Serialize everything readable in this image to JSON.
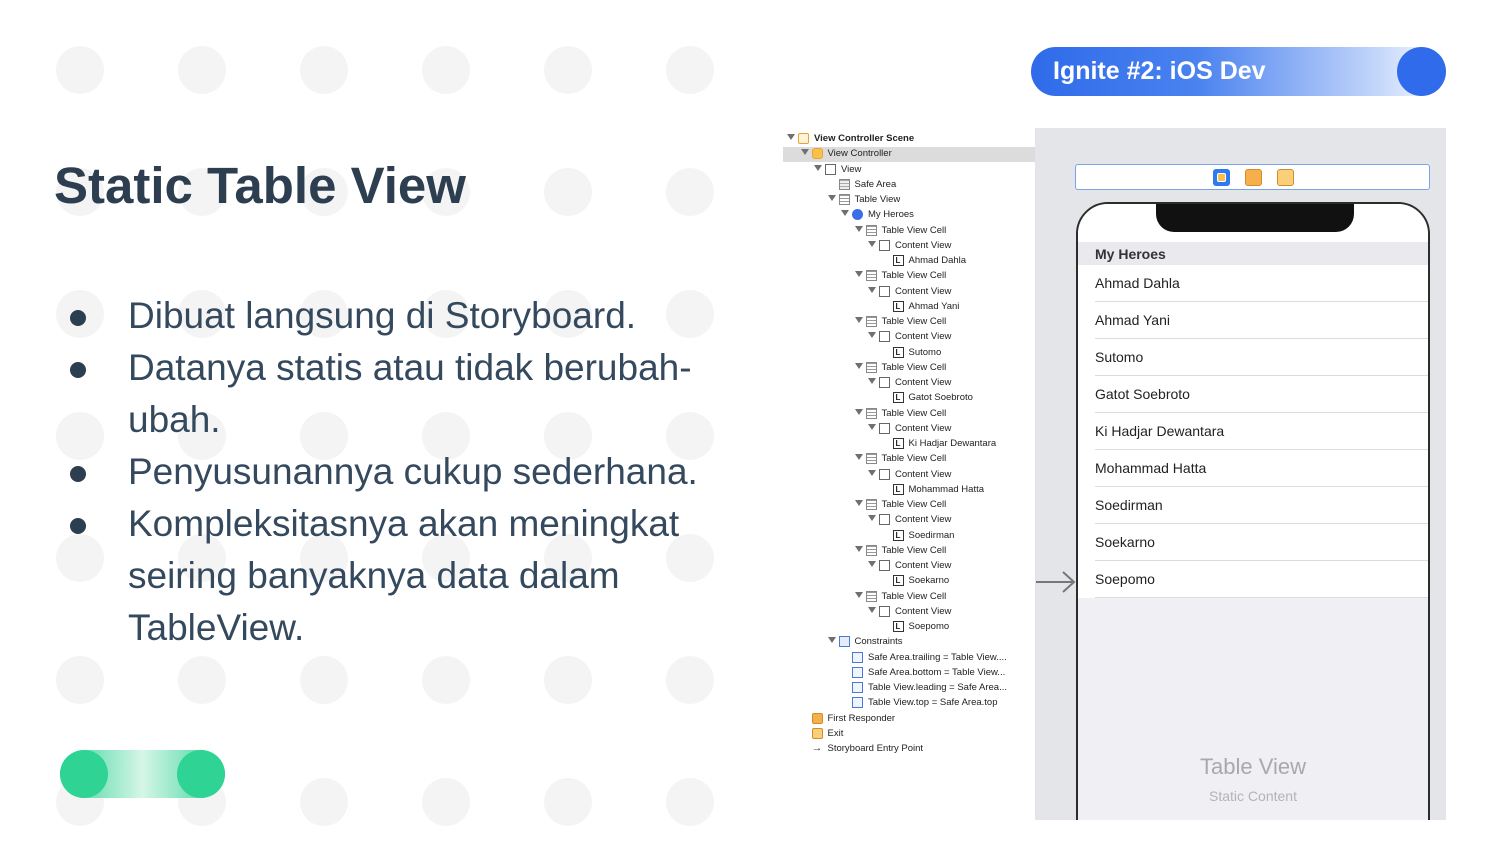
{
  "badge": {
    "text": "Ignite #2: iOS Dev"
  },
  "slide": {
    "title": "Static Table View",
    "bullets": [
      "Dibuat langsung di Storyboard.",
      "Datanya statis atau tidak berubah-ubah.",
      "Penyusunannya cukup sederhana.",
      "Kompleksitasnya akan meningkat seiring banyaknya data dalam TableView."
    ]
  },
  "outline": {
    "scene": "View Controller Scene",
    "view_controller": "View Controller",
    "view": "View",
    "safe_area": "Safe Area",
    "table_view": "Table View",
    "section": "My Heroes",
    "cell_label": "Table View Cell",
    "content_view_label": "Content View",
    "constraints": "Constraints",
    "constraint_items": [
      "Safe Area.trailing = Table View....",
      "Safe Area.bottom = Table View...",
      "Table View.leading = Safe Area...",
      "Table View.top = Safe Area.top"
    ],
    "first_responder": "First Responder",
    "exit": "Exit",
    "entry_point": "Storyboard Entry Point"
  },
  "canvas": {
    "section_header": "My Heroes",
    "cells": [
      "Ahmad Dahla",
      "Ahmad Yani",
      "Sutomo",
      "Gatot Soebroto",
      "Ki Hadjar Dewantara",
      "Mohammad Hatta",
      "Soedirman",
      "Soekarno",
      "Soepomo"
    ],
    "placeholder_title": "Table View",
    "placeholder_subtitle": "Static Content"
  },
  "colors": {
    "accent_blue": "#2f6bea",
    "accent_green": "#2fd393",
    "title_text": "#2c3e50"
  }
}
